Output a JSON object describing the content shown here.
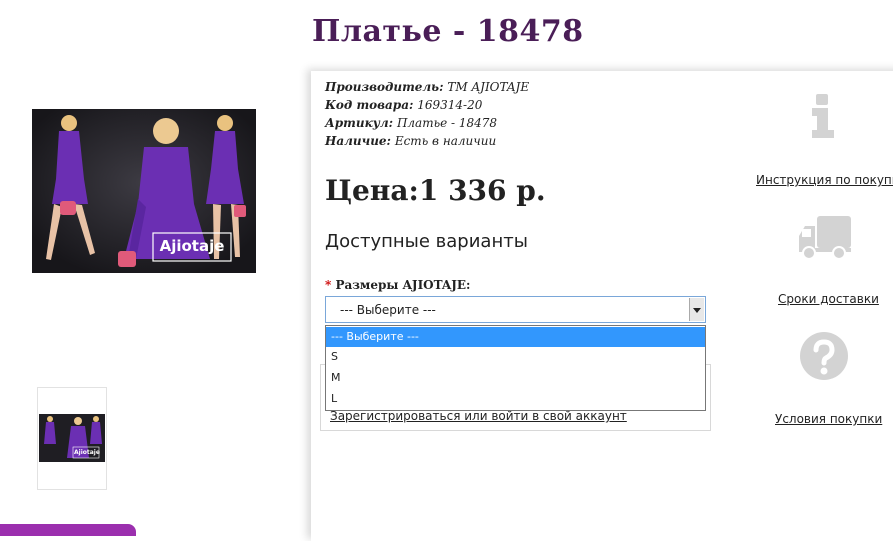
{
  "product": {
    "title": "Платье - 18478",
    "manufacturer_label": "Производитель:",
    "manufacturer_value": "ТМ AJIOTAJE",
    "code_label": "Код товара:",
    "code_value": "169314-20",
    "article_label": "Артикул:",
    "article_value": "Платье - 18478",
    "availability_label": "Наличие:",
    "availability_value": "Есть в наличии",
    "price": "Цена:1 336 р.",
    "image_logo": "Ajiotaje",
    "thumb_logo": "Ajiotaje"
  },
  "options": {
    "heading": "Доступные варианты",
    "required_mark": "*",
    "size_label": "Размеры AJIOTAJE:",
    "selected": "--- Выберите ---",
    "items": [
      "--- Выберите ---",
      "S",
      "M",
      "L"
    ]
  },
  "account": {
    "login_link": "Зарегистрироваться или войти в свой аккаунт"
  },
  "sidebar": {
    "instruction_label": "Инструкция по покупке",
    "delivery_label": "Сроки доставки",
    "terms_label": "Условия покупки",
    "instruction_icon": "info-icon",
    "delivery_icon": "truck-icon",
    "terms_icon": "question-icon"
  },
  "colors": {
    "title": "#4a1e57",
    "dress": "#6b2fb3",
    "highlight": "#3297fd",
    "icon": "#d3d3d3",
    "accent_bar": "#9b2fae"
  }
}
